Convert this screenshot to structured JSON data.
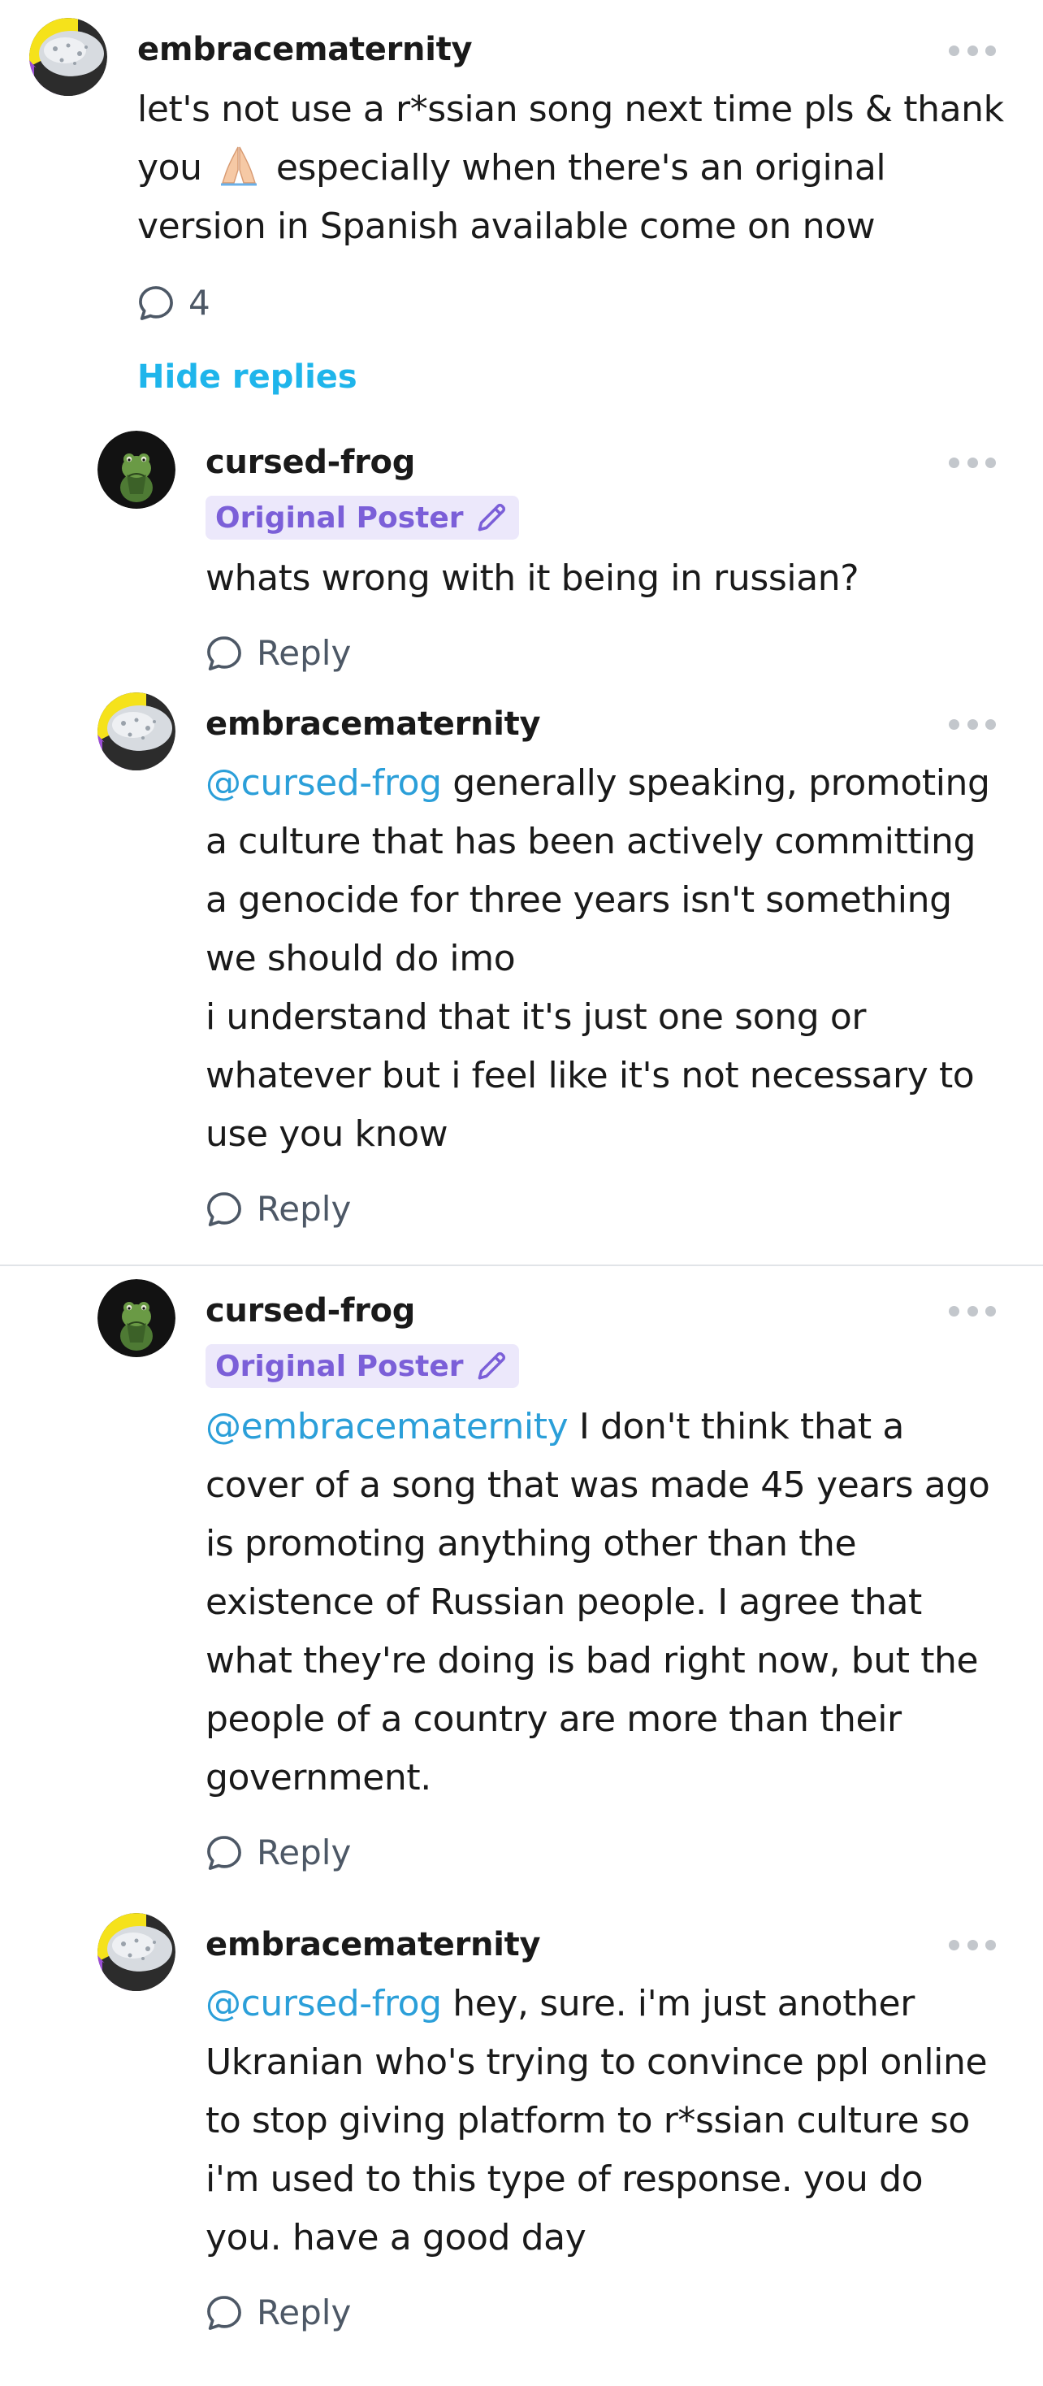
{
  "thread": {
    "hide_replies_label": "Hide replies",
    "reply_label": "Reply",
    "op_badge_label": "Original Poster"
  },
  "comments": [
    {
      "username": "embracematernity",
      "lines": [
        "let's not use a r*ssian song next time pls & thank",
        "especially when there's an original",
        "version in Spanish available come on now"
      ],
      "line2_prefix": "you",
      "emoji": "folded-hands-emoji",
      "reply_count": "4"
    },
    {
      "username": "cursed-frog",
      "is_op": true,
      "lines": [
        "whats wrong with it being in russian?"
      ]
    },
    {
      "username": "embracematernity",
      "mention": "@cursed-frog",
      "first_line_rest": "generally speaking, promoting",
      "lines": [
        "a culture that has been actively committing",
        "a genocide for three years isn't something",
        "we should do imo",
        "i understand that it's just one song or",
        "whatever but i feel like it's not necessary to",
        "use you know"
      ]
    },
    {
      "username": "cursed-frog",
      "is_op": true,
      "mention": "@embracematernity",
      "first_line_rest": "I don't think that a",
      "lines": [
        "cover of a song that was made 45 years ago",
        "is promoting anything other than the",
        "existence of Russian people. I agree that",
        "what they're doing is bad right now, but the",
        "people of a country are more than their",
        "government."
      ]
    },
    {
      "username": "embracematernity",
      "mention": "@cursed-frog",
      "first_line_rest": "hey, sure. i'm just another",
      "lines": [
        "Ukranian who's trying to convince ppl online",
        "to stop giving platform to r*ssian culture so",
        "i'm used to this type of response. you do",
        "you. have a good day"
      ]
    }
  ],
  "colors": {
    "mention": "#2b9fd9",
    "hide_replies": "#1fb5eb",
    "op_badge_bg": "#ece8fb",
    "op_badge_text": "#7b5fd8",
    "action_text": "#4d5866"
  }
}
